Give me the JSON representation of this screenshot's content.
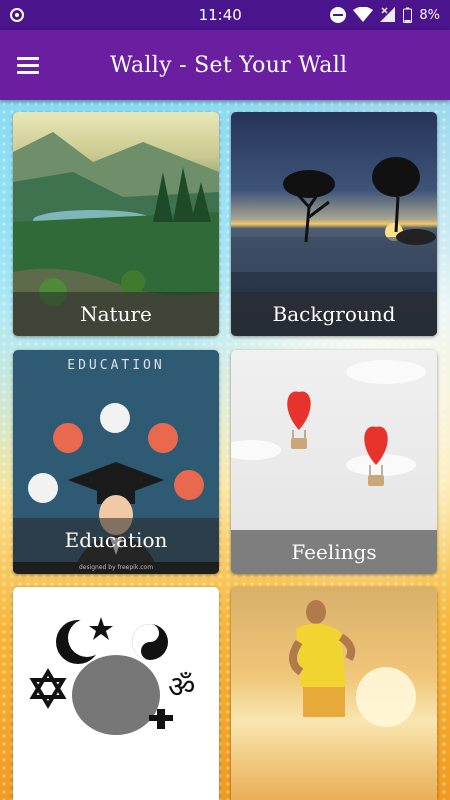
{
  "status_bar": {
    "time": "11:40",
    "battery": "8%",
    "icons": [
      "record-icon",
      "dnd-icon",
      "wifi-icon",
      "signal-icon",
      "battery-icon"
    ]
  },
  "app_bar": {
    "title": "Wally - Set Your Wall",
    "menu_icon": "hamburger-menu-icon"
  },
  "categories": [
    {
      "label": "Nature"
    },
    {
      "label": "Background"
    },
    {
      "label": "Education",
      "image_text": "EDUCATION",
      "credit": "designed by freepik.com"
    },
    {
      "label": "Feelings"
    },
    {
      "label": ""
    },
    {
      "label": ""
    }
  ],
  "colors": {
    "app_bar": "#6a1fa0",
    "status_bar": "#4a148c"
  }
}
